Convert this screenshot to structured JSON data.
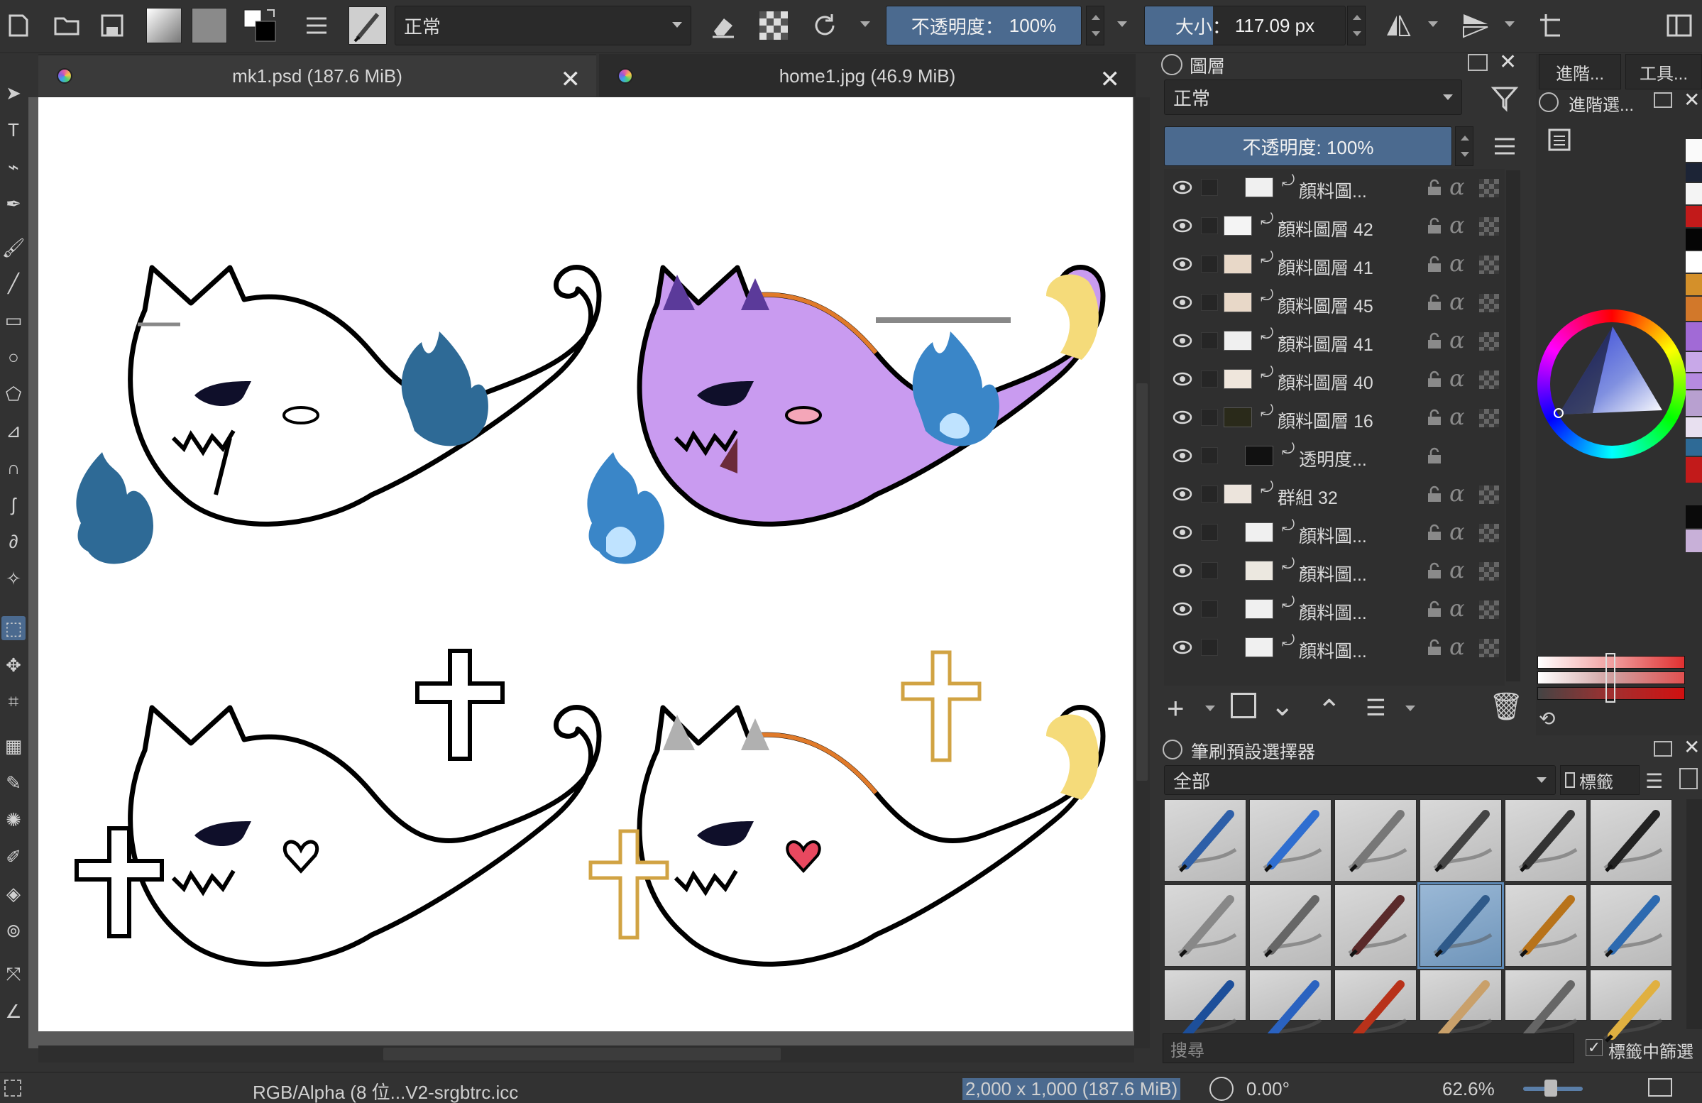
{
  "toolbar": {
    "blend_mode": "正常",
    "opacity_label": "不透明度：",
    "opacity_value": "100%",
    "size_label": "大小：",
    "size_value": "117.09 px"
  },
  "tabs": [
    {
      "label": "mk1.psd (187.6 MiB)",
      "close": "✕"
    },
    {
      "label": "home1.jpg (46.9 MiB)",
      "close": "✕"
    }
  ],
  "layers_docker": {
    "title": "圖層",
    "blend_mode": "正常",
    "opacity_label": "不透明度: 100%",
    "layers": [
      {
        "name": "顏料圖..."
      },
      {
        "name": "顏料圖層 42"
      },
      {
        "name": "顏料圖層 41"
      },
      {
        "name": "顏料圖層 45"
      },
      {
        "name": "顏料圖層 41"
      },
      {
        "name": "顏料圖層 40"
      },
      {
        "name": "顏料圖層 16"
      },
      {
        "name": "透明度..."
      },
      {
        "name": "群組 32"
      },
      {
        "name": "顏料圖..."
      },
      {
        "name": "顏料圖..."
      },
      {
        "name": "顏料圖..."
      },
      {
        "name": "顏料圖..."
      }
    ]
  },
  "right_tabs": {
    "advanced": "進階...",
    "tools": "工具...",
    "advanced_select": "進階選..."
  },
  "brush_docker": {
    "title": "筆刷預設選擇器",
    "filter": "全部",
    "tag_label": "標籤",
    "search_placeholder": "搜尋",
    "filter_in_tag": "標籤中篩選"
  },
  "statusbar": {
    "color_space": "RGB/Alpha (8 位...V2-srgbtrc.icc",
    "dimensions": "2,000 x 1,000 (187.6 MiB)",
    "rotation": "0.00°",
    "zoom": "62.6%"
  },
  "colors": {
    "accent": "#4b6a8f",
    "panel_bg": "#323232",
    "purple_ghost": "#c99bf0",
    "fire_blue": "#2e6a96",
    "cross_gold": "#d1a343"
  }
}
